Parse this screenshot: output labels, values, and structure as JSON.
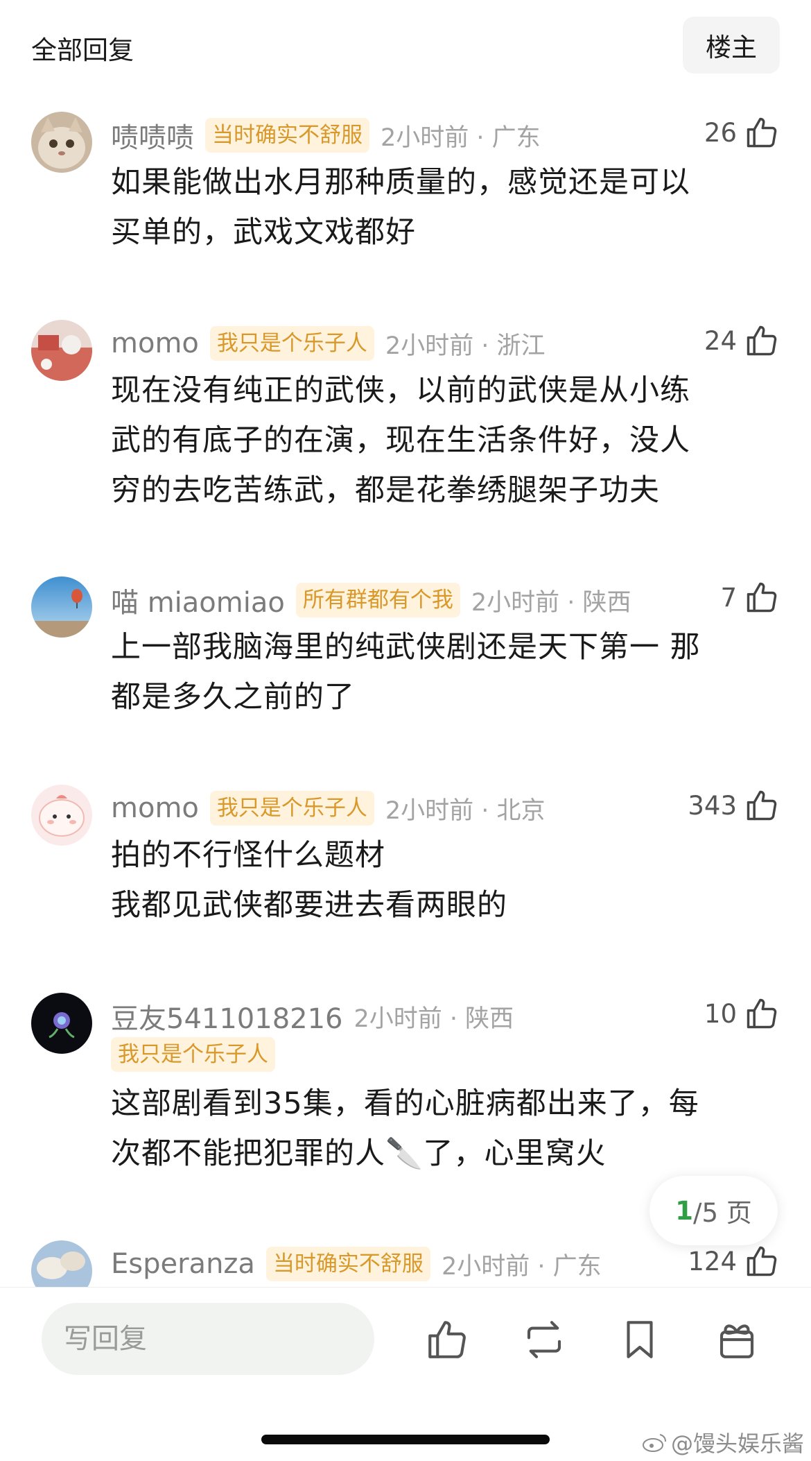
{
  "header": {
    "title": "全部回复",
    "owner_button": "楼主"
  },
  "comments": [
    {
      "username": "啧啧啧",
      "tag": "当时确实不舒服",
      "time": "2小时前 · 广东",
      "likes": "26",
      "text": "如果能做出水月那种质量的，感觉还是可以\n买单的，武戏文戏都好"
    },
    {
      "username": "momo",
      "tag": "我只是个乐子人",
      "time": "2小时前 · 浙江",
      "likes": "24",
      "text": "现在没有纯正的武侠，以前的武侠是从小练\n武的有底子的在演，现在生活条件好，没人\n穷的去吃苦练武，都是花拳绣腿架子功夫"
    },
    {
      "username": "喵 miaomiao",
      "tag": "所有群都有个我",
      "time": "2小时前 · 陕西",
      "likes": "7",
      "text": "上一部我脑海里的纯武侠剧还是天下第一 那\n都是多久之前的了"
    },
    {
      "username": "momo",
      "tag": "我只是个乐子人",
      "time": "2小时前 · 北京",
      "likes": "343",
      "text": "拍的不行怪什么题材\n我都见武侠都要进去看两眼的"
    },
    {
      "username": "豆友5411018216",
      "tag": "我只是个乐子人",
      "time": "2小时前 · 陕西",
      "likes": "10",
      "text": "这部剧看到35集，看的心脏病都出来了，每\n次都不能把犯罪的人🔪了，心里窝火"
    },
    {
      "username": "Esperanza",
      "tag": "当时确实不舒服",
      "time": "2小时前 · 广东",
      "likes": "124",
      "text": ""
    }
  ],
  "pagination": {
    "current": "1",
    "total": "/5 页"
  },
  "bottom_bar": {
    "reply_placeholder": "写回复"
  },
  "watermark": "@馒头娱乐酱",
  "colors": {
    "tag_text": "#d9982a",
    "tag_bg": "#fff3dd",
    "page_current": "#2f9e44"
  }
}
